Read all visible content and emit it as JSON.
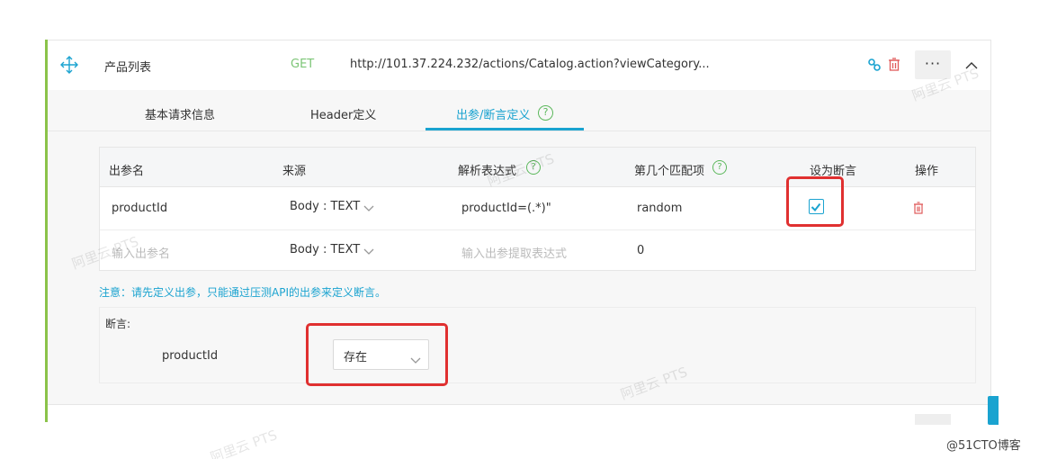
{
  "api": {
    "name": "产品列表",
    "method": "GET",
    "url": "http://101.37.224.232/actions/Catalog.action?viewCategory...",
    "more_label": "···"
  },
  "tabs": [
    {
      "label": "基本请求信息"
    },
    {
      "label": "Header定义"
    },
    {
      "label": "出参/断言定义",
      "active": true
    }
  ],
  "help_glyph": "?",
  "table": {
    "columns": [
      "出参名",
      "来源",
      "解析表达式",
      "第几个匹配项",
      "设为断言",
      "操作"
    ],
    "rows": [
      {
        "name": "productId",
        "source": "Body : TEXT",
        "expression": "productId=(.*)\"",
        "match": "random",
        "assert_checked": true
      },
      {
        "name_placeholder": "输入出参名",
        "source": "Body : TEXT",
        "expression_placeholder": "输入出参提取表达式",
        "match": "0"
      }
    ]
  },
  "notice": "注意：请先定义出参，只能通过压测API的出参来定义断言。",
  "assertion": {
    "title": "断言:",
    "param": "productId",
    "condition": "存在"
  },
  "watermark": "阿里云 PTS",
  "footer_watermark": "@51CTO博客",
  "colors": {
    "accent": "#1aa3d0",
    "method_get": "#7cc576",
    "card_left_bar": "#8bc34a",
    "help_icon": "#5cb85c",
    "highlight": "#e03030",
    "delete": "#e05a5a"
  },
  "icons": [
    "move-icon",
    "link-icon",
    "trash-icon",
    "more-icon",
    "collapse-icon",
    "help-icon",
    "chevron-down-icon",
    "check-icon"
  ]
}
